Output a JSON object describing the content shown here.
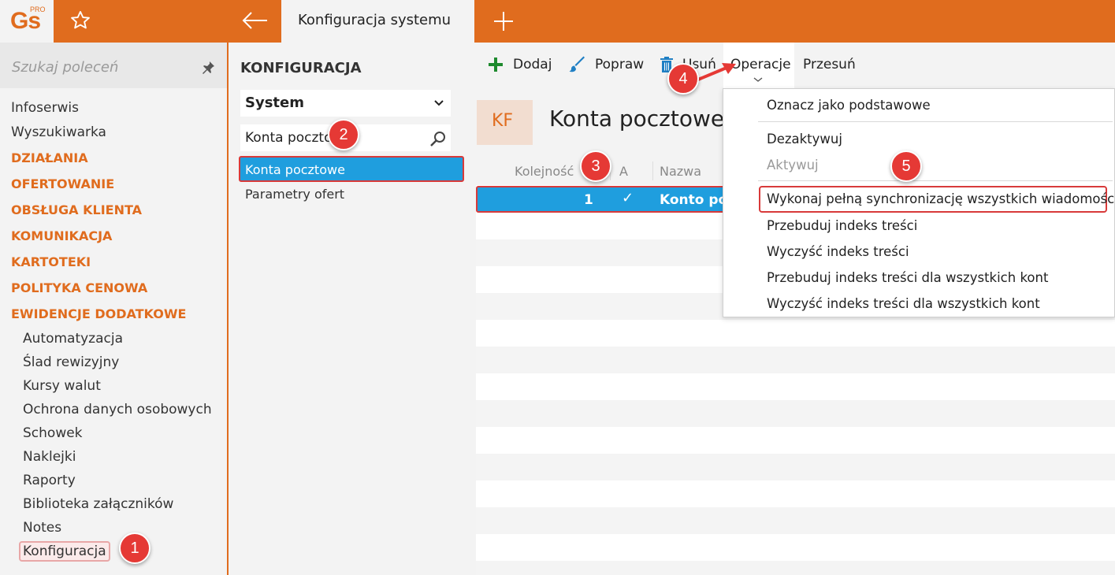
{
  "app": {
    "logo_text": "Gs",
    "logo_badge": "PRO",
    "active_tab": "Konfiguracja systemu",
    "brand_color": "#e06c1e",
    "selection_color": "#1f9ede",
    "highlight_color": "#d83a3a"
  },
  "sidebar": {
    "search_placeholder": "Szukaj poleceń",
    "items": [
      {
        "label": "Infoserwis",
        "kind": "item"
      },
      {
        "label": "Wyszukiwarka",
        "kind": "item"
      },
      {
        "label": "DZIAŁANIA",
        "kind": "category"
      },
      {
        "label": "OFERTOWANIE",
        "kind": "category"
      },
      {
        "label": "OBSŁUGA KLIENTA",
        "kind": "category"
      },
      {
        "label": "KOMUNIKACJA",
        "kind": "category"
      },
      {
        "label": "KARTOTEKI",
        "kind": "category"
      },
      {
        "label": "POLITYKA CENOWA",
        "kind": "category"
      },
      {
        "label": "EWIDENCJE DODATKOWE",
        "kind": "category"
      },
      {
        "label": "Automatyzacja",
        "kind": "sub"
      },
      {
        "label": "Ślad rewizyjny",
        "kind": "sub"
      },
      {
        "label": "Kursy walut",
        "kind": "sub"
      },
      {
        "label": "Ochrona danych osobowych",
        "kind": "sub"
      },
      {
        "label": "Schowek",
        "kind": "sub"
      },
      {
        "label": "Naklejki",
        "kind": "sub"
      },
      {
        "label": "Raporty",
        "kind": "sub"
      },
      {
        "label": "Biblioteka załączników",
        "kind": "sub"
      },
      {
        "label": "Notes",
        "kind": "sub"
      },
      {
        "label": "Konfiguracja",
        "kind": "sub"
      }
    ]
  },
  "config": {
    "title": "KONFIGURACJA",
    "section": "System",
    "filter_value": "Konta pocztowe",
    "items": [
      "Konta pocztowe",
      "Parametry ofert"
    ]
  },
  "toolbar": {
    "add": "Dodaj",
    "edit": "Popraw",
    "delete": "Usuń",
    "operations": "Operacje",
    "move": "Przesuń"
  },
  "main": {
    "badge": "KF",
    "title": "Konta pocztowe",
    "columns": [
      "Kolejność",
      "A",
      "Nazwa"
    ],
    "row": {
      "order": "1",
      "active": "✓",
      "name": "Konto po"
    }
  },
  "operations_menu": {
    "items": [
      {
        "label": "Oznacz jako podstawowe",
        "enabled": true
      },
      {
        "label": "Dezaktywuj",
        "enabled": true
      },
      {
        "label": "Aktywuj",
        "enabled": false
      },
      {
        "label": "Wykonaj pełną synchronizację wszystkich wiadomości",
        "enabled": true
      },
      {
        "label": "Przebuduj indeks treści",
        "enabled": true
      },
      {
        "label": "Wyczyść indeks treści",
        "enabled": true
      },
      {
        "label": "Przebuduj indeks treści dla wszystkich kont",
        "enabled": true
      },
      {
        "label": "Wyczyść indeks treści dla wszystkich kont",
        "enabled": true
      }
    ]
  },
  "annotations": [
    "1",
    "2",
    "3",
    "4",
    "5"
  ]
}
